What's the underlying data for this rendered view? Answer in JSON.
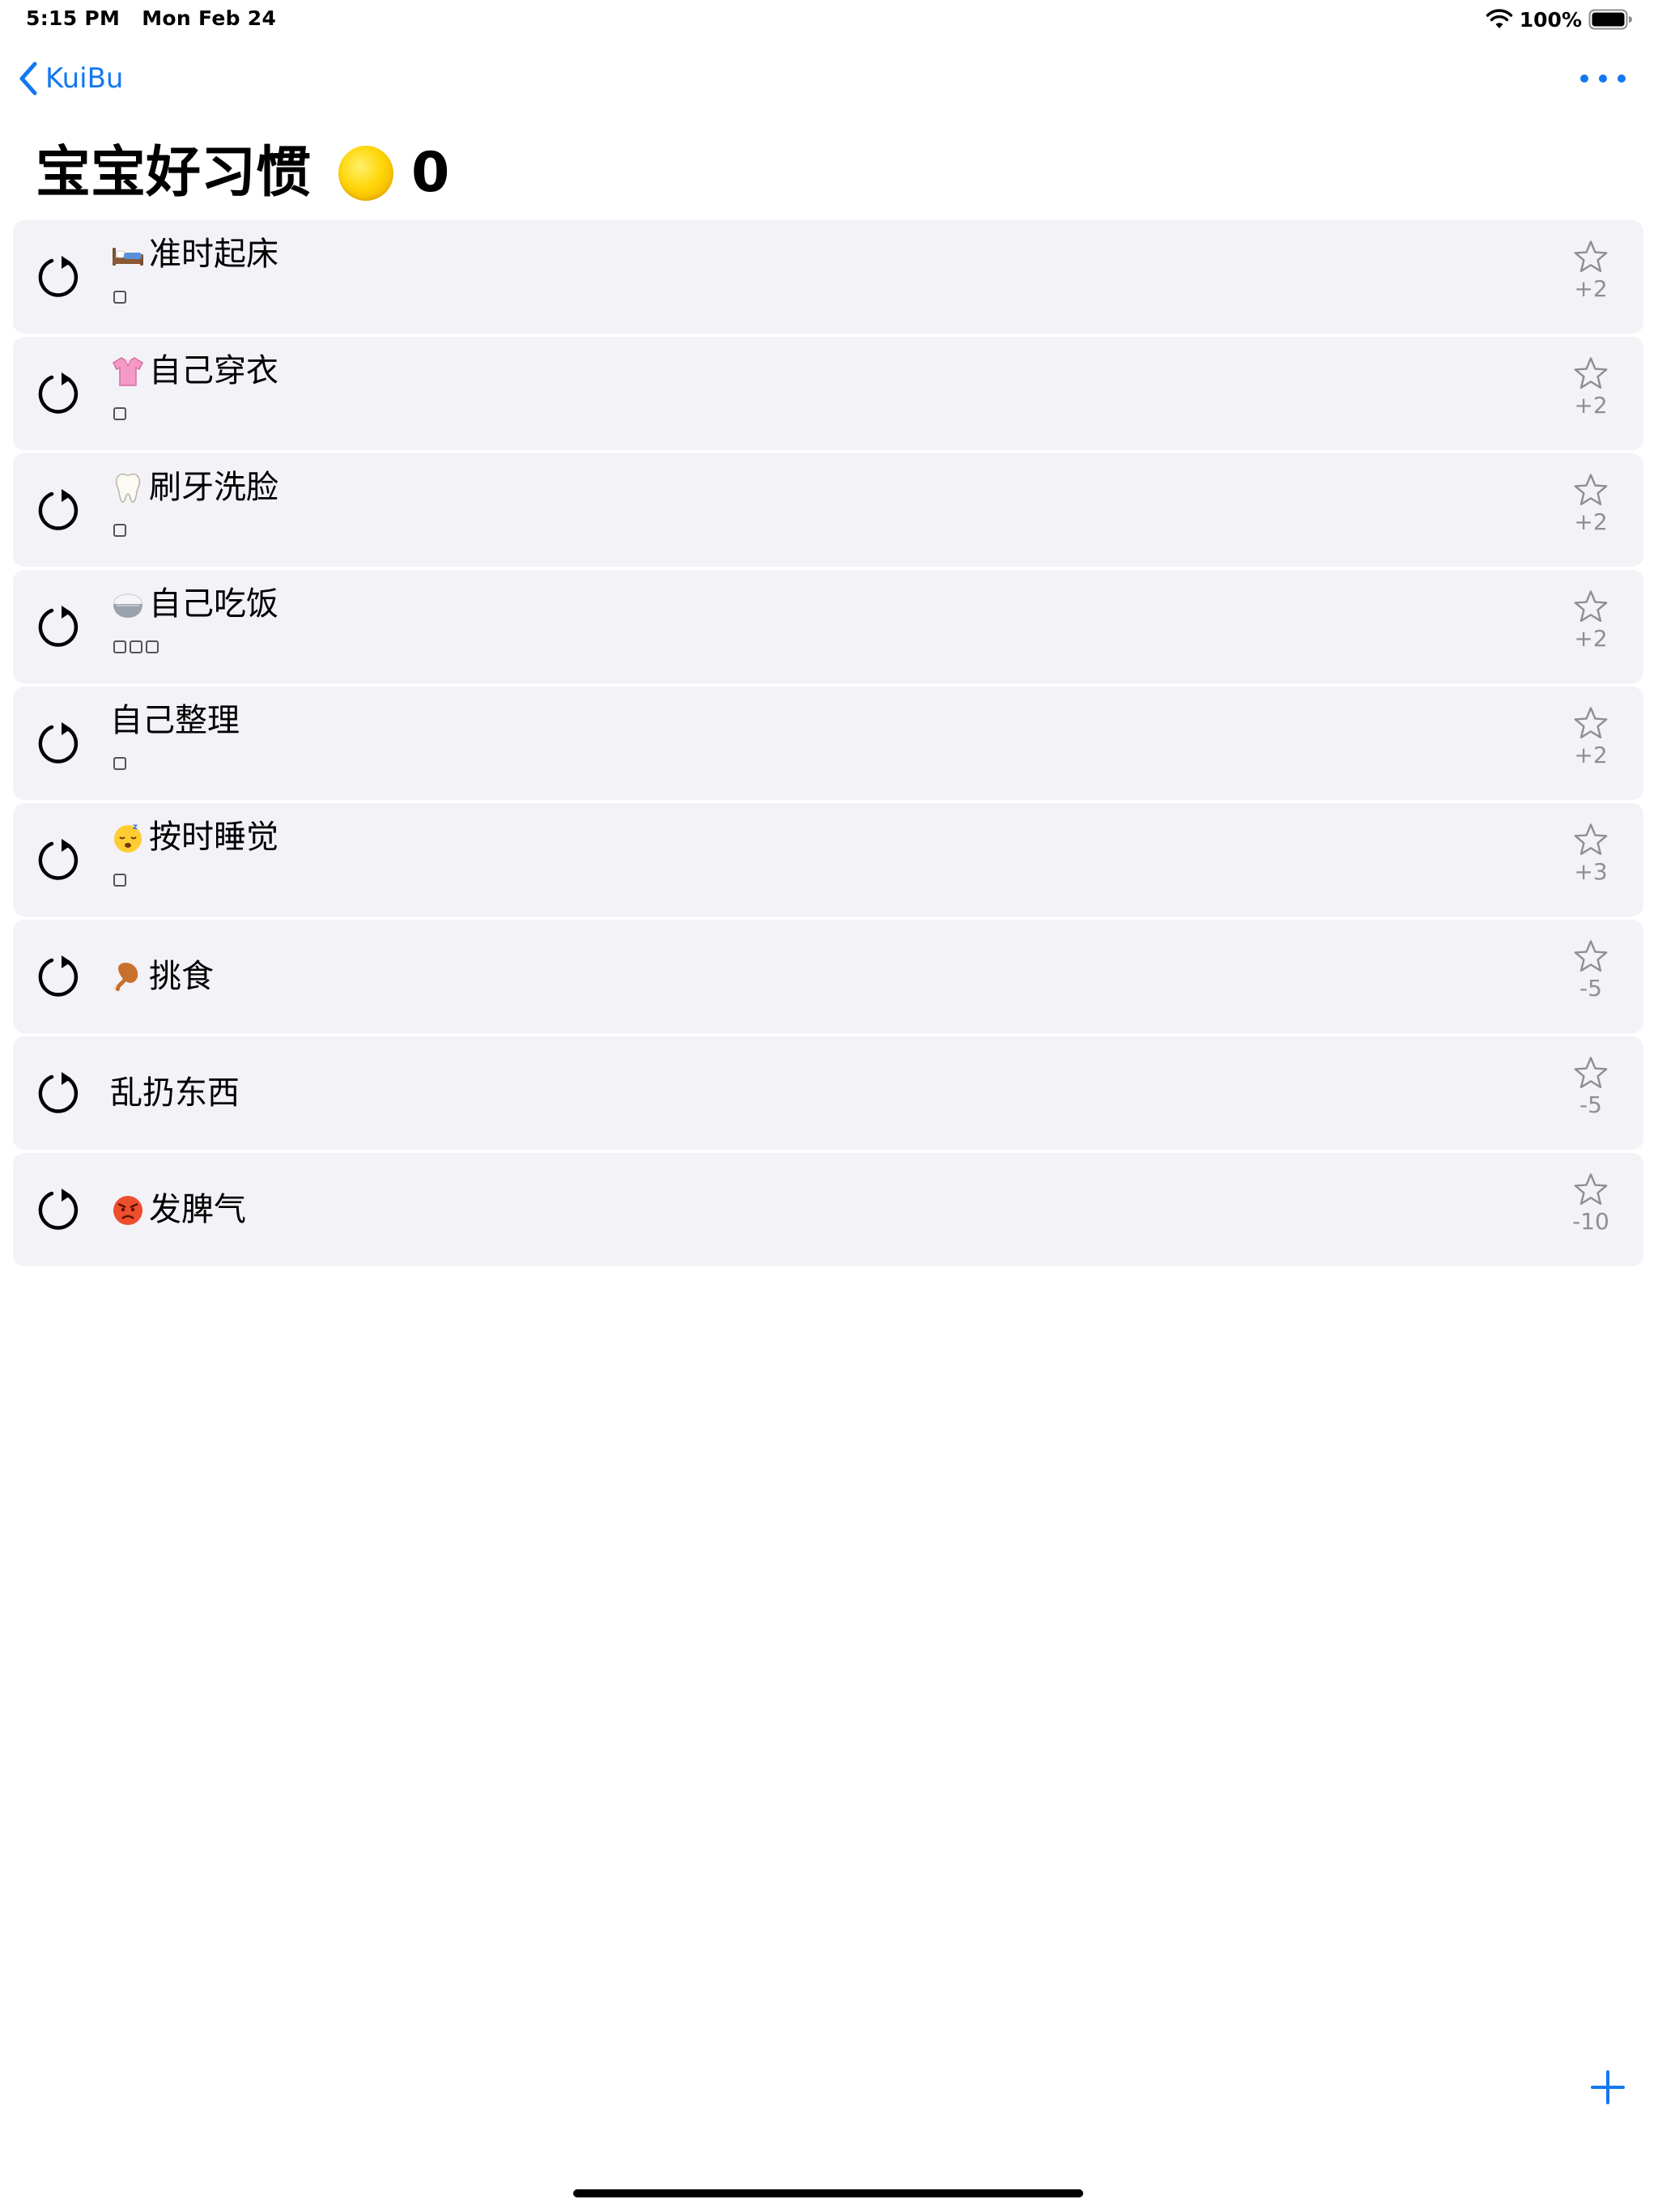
{
  "status_bar": {
    "time": "5:15 PM",
    "date": "Mon Feb 24",
    "battery": "100%",
    "icons": [
      "wifi-icon",
      "battery-icon"
    ]
  },
  "nav": {
    "back_label": "KuiBu",
    "back_icon": "chevron-left-icon",
    "more_icon": "ellipsis-icon"
  },
  "header": {
    "title": "宝宝好习惯",
    "coin_icon": "yellow-circle-icon",
    "score": "0"
  },
  "colors": {
    "accent": "#1378f0",
    "row_background": "#f2f2f7",
    "secondary_text": "#8e8e93"
  },
  "habits": [
    {
      "emoji": "bed-icon",
      "name": "准时起床",
      "boxes": 1,
      "points": "+2"
    },
    {
      "emoji": "shirt-icon",
      "name": "自己穿衣",
      "boxes": 1,
      "points": "+2"
    },
    {
      "emoji": "tooth-icon",
      "name": "刷牙洗脸",
      "boxes": 1,
      "points": "+2"
    },
    {
      "emoji": "rice-bowl-icon",
      "name": "自己吃饭",
      "boxes": 3,
      "points": "+2"
    },
    {
      "emoji": "",
      "name": "自己整理",
      "boxes": 1,
      "points": "+2"
    },
    {
      "emoji": "sleeping-face-icon",
      "name": "按时睡觉",
      "boxes": 1,
      "points": "+3"
    },
    {
      "emoji": "drumstick-icon",
      "name": "挑食",
      "boxes": 0,
      "points": "-5"
    },
    {
      "emoji": "",
      "name": "乱扔东西",
      "boxes": 0,
      "points": "-5"
    },
    {
      "emoji": "angry-face-icon",
      "name": "发脾气",
      "boxes": 0,
      "points": "-10"
    }
  ],
  "footer": {
    "add_icon": "plus-icon"
  }
}
